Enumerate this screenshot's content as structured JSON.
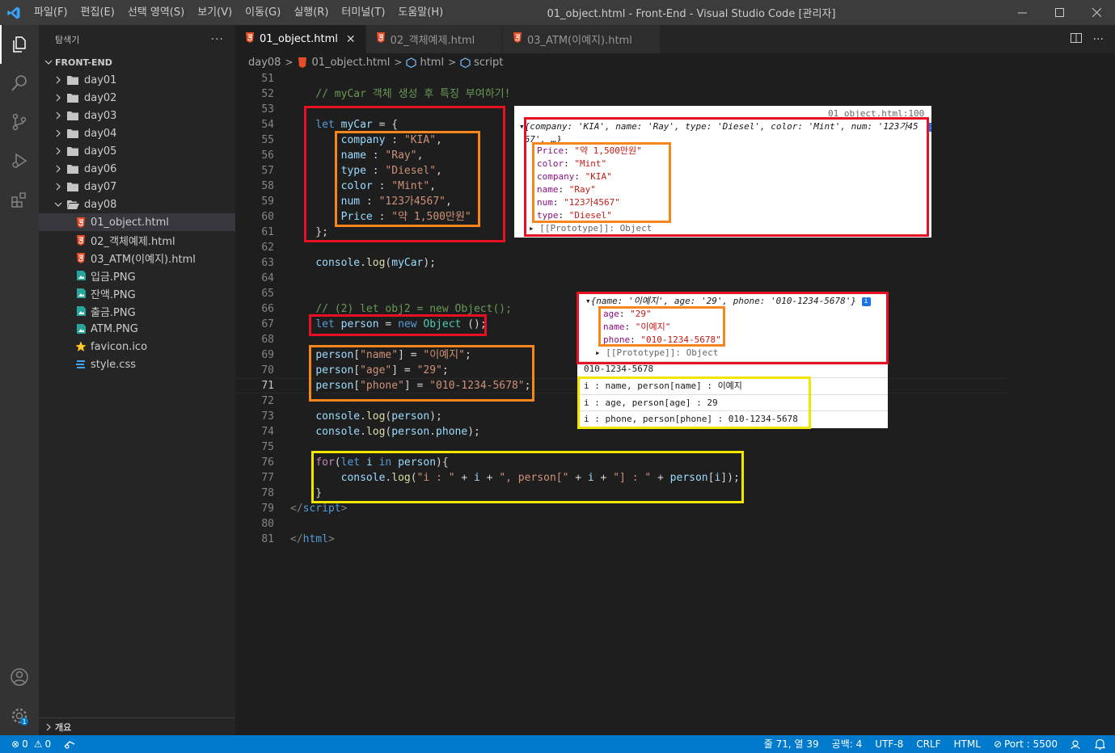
{
  "titlebar": {
    "menus": [
      "파일(F)",
      "편집(E)",
      "선택 영역(S)",
      "보기(V)",
      "이동(G)",
      "실행(R)",
      "터미널(T)",
      "도움말(H)"
    ],
    "title": "01_object.html - Front-End - Visual Studio Code [관리자]"
  },
  "sidebar": {
    "title": "탐색기",
    "more": "···",
    "folder": "FRONT-END",
    "folders": [
      "day01",
      "day02",
      "day03",
      "day04",
      "day05",
      "day06",
      "day07",
      "day08"
    ],
    "files": [
      {
        "name": "01_object.html",
        "type": "html"
      },
      {
        "name": "02_객체예제.html",
        "type": "html"
      },
      {
        "name": "03_ATM(이예지).html",
        "type": "html"
      },
      {
        "name": "입금.PNG",
        "type": "image"
      },
      {
        "name": "잔액.PNG",
        "type": "image"
      },
      {
        "name": "출금.PNG",
        "type": "image"
      },
      {
        "name": "ATM.PNG",
        "type": "image"
      },
      {
        "name": "favicon.ico",
        "type": "star"
      },
      {
        "name": "style.css",
        "type": "css"
      }
    ],
    "outline": "개요"
  },
  "tabs": [
    {
      "label": "01_object.html",
      "active": true
    },
    {
      "label": "02_객체예제.html",
      "active": false
    },
    {
      "label": "03_ATM(이예지).html",
      "active": false
    }
  ],
  "breadcrumb": {
    "folder": "day08",
    "file": "01_object.html",
    "html": "html",
    "script": "script"
  },
  "editor": {
    "line_numbers": [
      "51",
      "52",
      "53",
      "54",
      "55",
      "56",
      "57",
      "58",
      "59",
      "60",
      "61",
      "62",
      "63",
      "64",
      "65",
      "66",
      "67",
      "68",
      "69",
      "70",
      "71",
      "72",
      "73",
      "74",
      "75",
      "76",
      "77",
      "78",
      "79",
      "80",
      "81"
    ],
    "active_line": "71"
  },
  "console1": {
    "file_link": "01_object.html:100",
    "summary": "{company: 'KIA', name: 'Ray', type: 'Diesel', color: 'Mint', num: '123가4567', …}",
    "props": [
      {
        "k": "Price",
        "v": "\"약 1,500만원\""
      },
      {
        "k": "color",
        "v": "\"Mint\""
      },
      {
        "k": "company",
        "v": "\"KIA\""
      },
      {
        "k": "name",
        "v": "\"Ray\""
      },
      {
        "k": "num",
        "v": "\"123가4567\""
      },
      {
        "k": "type",
        "v": "\"Diesel\""
      }
    ],
    "proto": "[[Prototype]]: Object"
  },
  "console2": {
    "summary": "{name: '이예지', age: '29', phone: '010-1234-5678'}",
    "props": [
      {
        "k": "age",
        "v": "\"29\""
      },
      {
        "k": "name",
        "v": "\"이예지\""
      },
      {
        "k": "phone",
        "v": "\"010-1234-5678\""
      }
    ],
    "proto": "[[Prototype]]: Object",
    "phone_log": "010-1234-5678",
    "loop_logs": [
      "i : name, person[name] : 이예지",
      "i : age, person[age] : 29",
      "i : phone, person[phone] : 010-1234-5678"
    ]
  },
  "statusbar": {
    "errors": "0",
    "warnings": "0",
    "position": "줄 71, 열 39",
    "spaces": "공백: 4",
    "encoding": "UTF-8",
    "eol": "CRLF",
    "language": "HTML",
    "port": "Port : 5500"
  },
  "colors": {
    "accent": "#007acc",
    "annotation_red": "#e81123",
    "annotation_orange": "#f7861c",
    "annotation_yellow": "#f2e600"
  }
}
